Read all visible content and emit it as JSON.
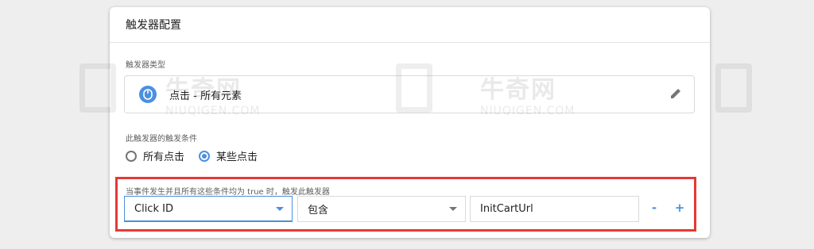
{
  "card": {
    "title": "触发器配置",
    "trigger_type_label": "触发器类型",
    "trigger_type_value": "点击 - 所有元素",
    "condition_section_label": "此触发器的触发条件",
    "radio_options": [
      {
        "label": "所有点击",
        "checked": false
      },
      {
        "label": "某些点击",
        "checked": true
      }
    ]
  },
  "condition": {
    "label": "当事件发生并且所有这些条件均为 true 时，触发此触发器",
    "variable": "Click ID",
    "operator": "包含",
    "value": "InitCartUrl",
    "remove_label": "-",
    "add_label": "+"
  },
  "watermark": {
    "text_cn": "牛奇网",
    "text_en": "NIUQIGEN.COM"
  },
  "colors": {
    "accent": "#4a90e2",
    "highlight": "#e53935"
  },
  "icons": [
    "mouse-icon",
    "edit-pencil-icon",
    "dropdown-caret-icon"
  ]
}
